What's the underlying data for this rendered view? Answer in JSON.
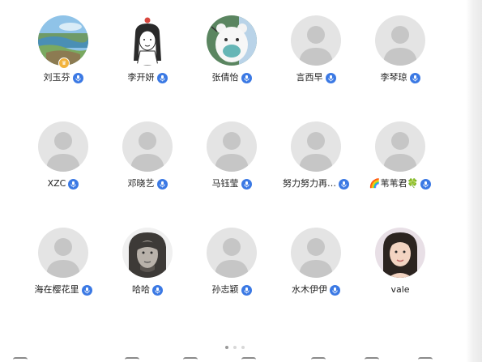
{
  "participants": [
    {
      "name": "刘玉芬",
      "avatar": "landscape-photo",
      "mic": "microphone-icon",
      "host": true
    },
    {
      "name": "李开妍",
      "avatar": "girl-drawing",
      "mic": "microphone-icon"
    },
    {
      "name": "张倩怡",
      "avatar": "bear-mask-cartoon",
      "mic": "microphone-icon"
    },
    {
      "name": "言西早",
      "avatar": "default-avatar",
      "mic": "microphone-icon"
    },
    {
      "name": "李琴琼",
      "avatar": "default-avatar",
      "mic": "microphone-icon"
    },
    {
      "name": "XZC",
      "avatar": "default-avatar",
      "mic": "microphone-icon"
    },
    {
      "name": "邓晓艺",
      "avatar": "default-avatar",
      "mic": "microphone-icon"
    },
    {
      "name": "马钰莹",
      "avatar": "default-avatar",
      "mic": "microphone-icon"
    },
    {
      "name": "努力努力再…",
      "avatar": "default-avatar",
      "mic": "microphone-icon"
    },
    {
      "name": "🌈苇苇君🍀",
      "avatar": "default-avatar",
      "mic": "microphone-icon"
    },
    {
      "name": "海在樱花里",
      "avatar": "default-avatar",
      "mic": "microphone-icon"
    },
    {
      "name": "哈哈",
      "avatar": "man-photo",
      "mic": "microphone-icon"
    },
    {
      "name": "孙志颖",
      "avatar": "default-avatar",
      "mic": "microphone-icon"
    },
    {
      "name": "水木伊伊",
      "avatar": "default-avatar",
      "mic": "microphone-icon"
    },
    {
      "name": "vale",
      "avatar": "woman-photo",
      "mic": null
    }
  ],
  "pager": {
    "pages": 3,
    "current": 1
  },
  "colors": {
    "mic_badge": "#3b79e4",
    "host_badge": "#f2b33d",
    "default_avatar_bg": "#e4e4e4",
    "default_avatar_figure": "#c6c6c6",
    "name_text": "#222222"
  }
}
